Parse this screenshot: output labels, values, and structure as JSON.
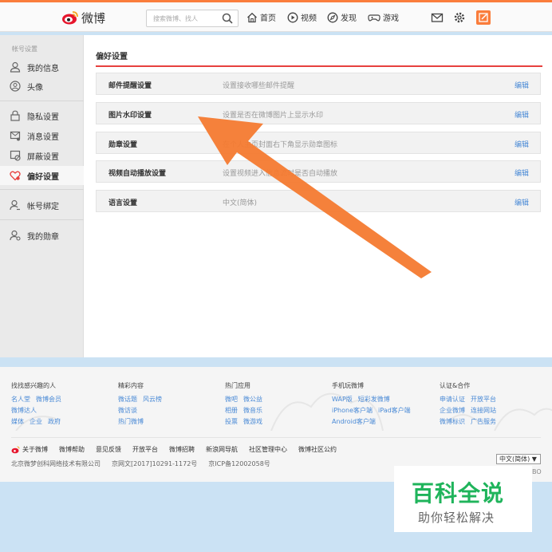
{
  "header": {
    "logo_text": "微博",
    "search": {
      "placeholder": "搜索微博、找人"
    },
    "nav": [
      {
        "label": "首页",
        "icon": "home-icon"
      },
      {
        "label": "视频",
        "icon": "video-icon"
      },
      {
        "label": "发现",
        "icon": "discover-icon"
      },
      {
        "label": "游戏",
        "icon": "game-icon"
      }
    ],
    "icons": [
      "mail-icon",
      "gear-icon",
      "compose-icon"
    ],
    "accent_color": "#fa7d3c"
  },
  "sidebar": {
    "group_label": "帐号设置",
    "items": [
      {
        "label": "我的信息",
        "icon": "user-icon"
      },
      {
        "label": "头像",
        "icon": "avatar-icon"
      },
      {
        "label": "隐私设置",
        "icon": "lock-icon"
      },
      {
        "label": "消息设置",
        "icon": "message-icon"
      },
      {
        "label": "屏蔽设置",
        "icon": "block-icon"
      },
      {
        "label": "偏好设置",
        "icon": "heart-gear-icon",
        "active": true
      },
      {
        "label": "帐号绑定",
        "icon": "user-link-icon"
      },
      {
        "label": "我的勋章",
        "icon": "medal-user-icon"
      }
    ]
  },
  "main": {
    "title": "偏好设置",
    "title_rule_color": "#e7413f",
    "rows": [
      {
        "name": "邮件提醒设置",
        "desc": "设置接收哪些邮件提醒",
        "action": "编辑"
      },
      {
        "name": "图片水印设置",
        "desc": "设置是否在微博图片上显示水印",
        "action": "编辑"
      },
      {
        "name": "勋章设置",
        "desc": "在个人主页封面右下角显示勋章图标",
        "action": "编辑"
      },
      {
        "name": "视频自动播放设置",
        "desc": "设置视频进入信息流时是否自动播放",
        "action": "编辑"
      },
      {
        "name": "语言设置",
        "desc": "中文(简体)",
        "action": "编辑"
      }
    ]
  },
  "footer": {
    "columns": [
      {
        "heading": "找找感兴趣的人",
        "links": [
          [
            "名人堂",
            "微博会员"
          ],
          [
            "微博达人"
          ],
          [
            "媒体",
            "企业",
            "政府"
          ]
        ]
      },
      {
        "heading": "精彩内容",
        "links": [
          [
            "微话题",
            "风云榜"
          ],
          [
            "微访谈"
          ],
          [
            "热门微博"
          ]
        ]
      },
      {
        "heading": "热门应用",
        "links": [
          [
            "微吧",
            "微公益"
          ],
          [
            "相册",
            "微音乐"
          ],
          [
            "投票",
            "微游戏"
          ]
        ]
      },
      {
        "heading": "手机玩微博",
        "links": [
          [
            "WAP版",
            "短彩发微博"
          ],
          [
            "iPhone客户端",
            "iPad客户端"
          ],
          [
            "Android客户端"
          ]
        ]
      },
      {
        "heading": "认证&合作",
        "links": [
          [
            "申请认证",
            "开放平台"
          ],
          [
            "企业微博",
            "连接网站"
          ],
          [
            "微博标识",
            "广告服务"
          ]
        ]
      }
    ],
    "bottom_links": [
      "关于微博",
      "微博帮助",
      "意见反馈",
      "开放平台",
      "微博招聘",
      "新浪网导航",
      "社区管理中心",
      "微博社区公约"
    ],
    "copyright": [
      "北京微梦创科网络技术有限公司",
      "京网文[2017]10291-1172号",
      "京ICP备12002058号"
    ],
    "language_select": "中文(简体) ▼",
    "corner_text": "BO"
  },
  "watermark": {
    "main": "百科全说",
    "sub": "助你轻松解决",
    "color": "#1fb45b"
  },
  "annotation": {
    "arrow_color": "#f47a30"
  }
}
